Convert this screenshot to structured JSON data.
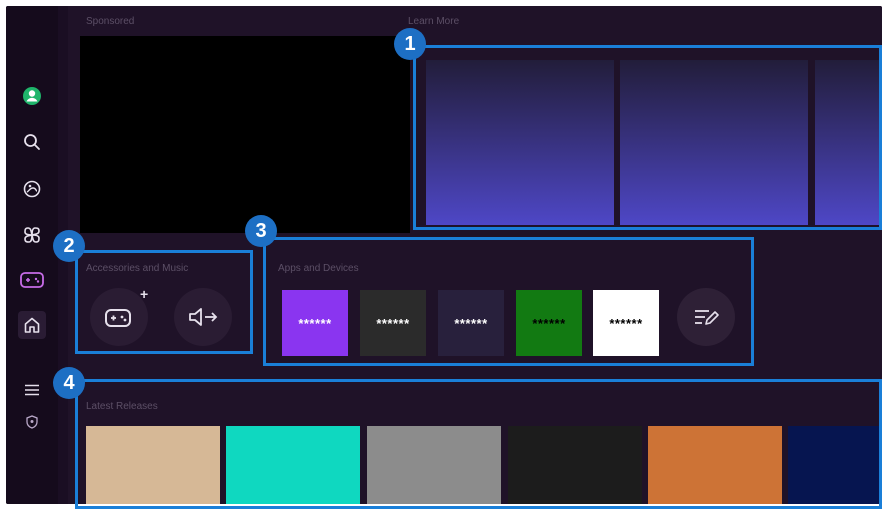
{
  "sections": {
    "sponsored": "Sponsored",
    "learn_more": "Learn More",
    "accessories": "Accessories and Music",
    "apps": "Apps and Devices",
    "latest": "Latest Releases"
  },
  "callouts": [
    "1",
    "2",
    "3",
    "4"
  ],
  "sidebar": {
    "icons": [
      "profile-icon",
      "search-icon",
      "ambient-icon",
      "apps-icon",
      "game-icon",
      "home-icon",
      "menu-icon",
      "privacy-icon"
    ]
  },
  "accessories": {
    "items": [
      "game-controller-add-icon",
      "speaker-output-icon"
    ],
    "plus": "+"
  },
  "apps": {
    "tiles": [
      {
        "label": "******",
        "bg": "#8a35f0",
        "fg": "#ffffff"
      },
      {
        "label": "******",
        "bg": "#2b2b2b",
        "fg": "#ffffff"
      },
      {
        "label": "******",
        "bg": "#28203c",
        "fg": "#ffffff"
      },
      {
        "label": "******",
        "bg": "#127a12",
        "fg": "#000000"
      },
      {
        "label": "******",
        "bg": "#ffffff",
        "fg": "#000000"
      }
    ],
    "edit_icon": "edit-list-icon"
  },
  "learn_more": {
    "tile_gradient": [
      "#221d3a",
      "#4e47c6"
    ]
  },
  "releases": {
    "colors": [
      "#d6b896",
      "#0fd8c0",
      "#8c8c8c",
      "#1c1c1c",
      "#cd7336",
      "#061550"
    ]
  },
  "colors": {
    "highlight": "#1a7fd8",
    "badge": "#1d6fc4",
    "background": "#1f1228"
  }
}
